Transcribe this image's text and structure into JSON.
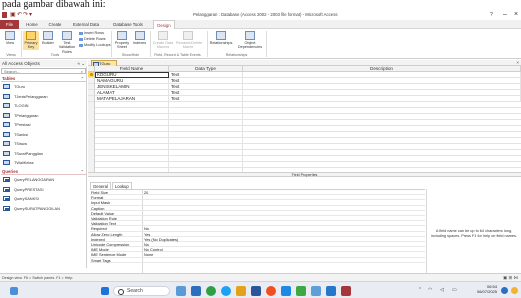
{
  "background_caption": "pada gambar dibawah ini:",
  "app": {
    "title": "Pelanggaran : Database (Access 2002 - 2003 file format) - Microsoft Access",
    "window_buttons": [
      "?",
      "–",
      "×"
    ]
  },
  "tabs": [
    "File",
    "Home",
    "Create",
    "External Data",
    "Database Tools",
    "Design"
  ],
  "ribbon": {
    "view_label": "View",
    "primary_key_label": "Primary Key",
    "builder_label": "Builder",
    "test_validation_label": "Test Validation Rules",
    "insert_rows": "Insert Rows",
    "delete_rows": "Delete Rows",
    "modify_lookups": "Modify Lookups",
    "property_sheet_label": "Property Sheet",
    "indexes_label": "Indexes",
    "create_data_macros": "Create Data Macros",
    "rename_delete_macro": "Rename/Delete Macro",
    "relationships_label": "Relationships",
    "object_dependencies_label": "Object Dependencies",
    "group_views": "Views",
    "group_tools": "Tools",
    "group_showhide": "Show/Hide",
    "group_field_events": "Field, Record & Table Events",
    "group_relationships": "Relationships"
  },
  "nav": {
    "header": "All Access Objects",
    "search_placeholder": "Search...",
    "tables_label": "Tables",
    "tables": [
      "TGuru",
      "TJenisPelanggaran",
      "TLOGIN",
      "TPelanggaran",
      "TPrestasi",
      "TSanksi",
      "TSiswa",
      "TSuratPanggilan",
      "TWaliKelas"
    ],
    "queries_label": "Queries",
    "queries": [
      "QueryPELANGGARAN",
      "QueryPRESTASI",
      "QuerySANKSI",
      "QuerySURATPANGGILAN"
    ]
  },
  "document_tab": "TGuru",
  "grid": {
    "headers": [
      "Field Name",
      "Data Type",
      "Description"
    ],
    "rows": [
      {
        "field": "KDGURU",
        "type": "Text"
      },
      {
        "field": "NAMAGURU",
        "type": "Text"
      },
      {
        "field": "JENISKELAMIN",
        "type": "Text"
      },
      {
        "field": "ALAMAT",
        "type": "Text"
      },
      {
        "field": "MATAPELAJARAN",
        "type": "Text"
      }
    ]
  },
  "field_properties": {
    "header": "Field Properties",
    "tab_general": "General",
    "tab_lookup": "Lookup",
    "props": [
      {
        "label": "Field Size",
        "value": "20"
      },
      {
        "label": "Format",
        "value": ""
      },
      {
        "label": "Input Mask",
        "value": ""
      },
      {
        "label": "Caption",
        "value": ""
      },
      {
        "label": "Default Value",
        "value": ""
      },
      {
        "label": "Validation Rule",
        "value": ""
      },
      {
        "label": "Validation Text",
        "value": ""
      },
      {
        "label": "Required",
        "value": "No"
      },
      {
        "label": "Allow Zero Length",
        "value": "Yes"
      },
      {
        "label": "Indexed",
        "value": "Yes (No Duplicates)"
      },
      {
        "label": "Unicode Compression",
        "value": "No"
      },
      {
        "label": "IME Mode",
        "value": "No Control"
      },
      {
        "label": "IME Sentence Mode",
        "value": "None"
      },
      {
        "label": "Smart Tags",
        "value": ""
      }
    ],
    "hint": "A field name can be up to 64 characters long, including spaces. Press F1 for help on field names."
  },
  "status": {
    "text": "Design view. F6 = Switch panes. F1 = Help.",
    "right": "▣ ⊞ ⋈"
  },
  "taskbar": {
    "search_label": "Search",
    "time": "06:54",
    "date": "06/07/2025"
  }
}
